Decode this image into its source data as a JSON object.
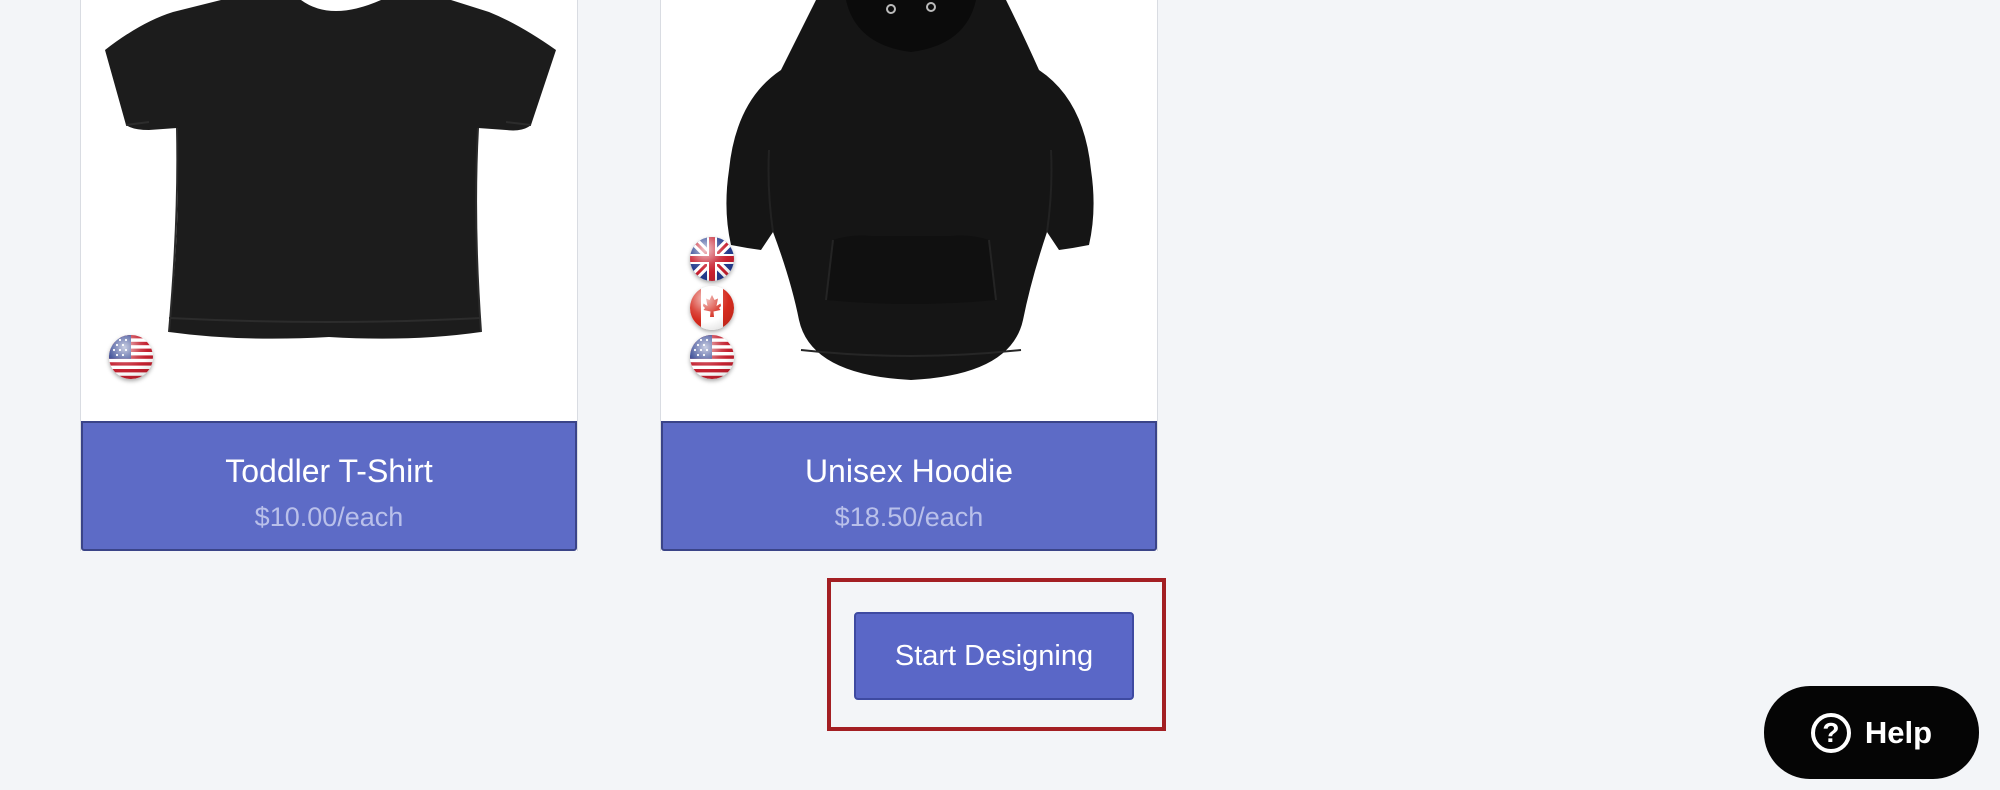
{
  "products": [
    {
      "name": "Toddler T-Shirt",
      "price": "$10.00/each",
      "image": "black-toddler-tshirt",
      "flags": [
        "us-flag-icon"
      ]
    },
    {
      "name": "Unisex Hoodie",
      "price": "$18.50/each",
      "image": "black-unisex-hoodie",
      "flags": [
        "uk-flag-icon",
        "canada-flag-icon",
        "us-flag-icon"
      ]
    }
  ],
  "actions": {
    "start_designing_label": "Start Designing"
  },
  "help": {
    "icon": "question-circle-icon",
    "label": "Help"
  },
  "colors": {
    "page_background": "#f3f5f8",
    "card_footer": "#5d6bc6",
    "price_text": "#b9c0ea",
    "primary_button": "#5a67c7",
    "highlight_border": "#a31f23",
    "help_button": "#050505"
  }
}
